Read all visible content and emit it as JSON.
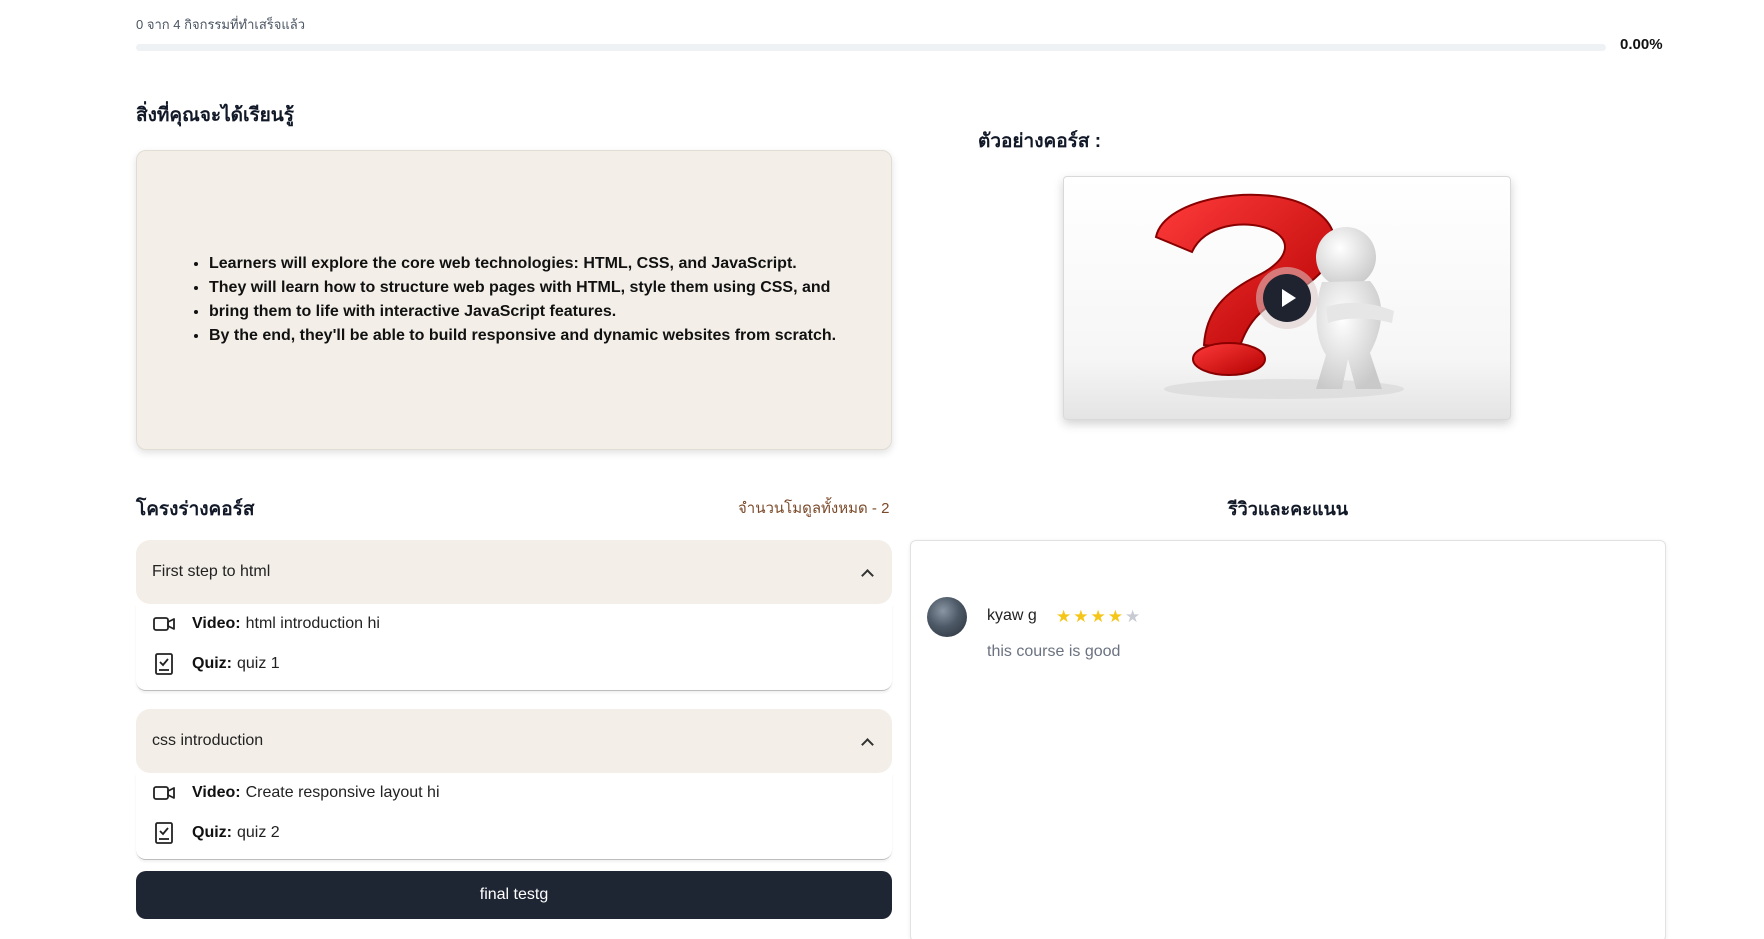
{
  "progress": {
    "text": "0 จาก 4 กิจกรรมที่ทำเสร็จแล้ว",
    "percent_label": "0.00%",
    "fraction": 0.0
  },
  "learn": {
    "title": "สิ่งที่คุณจะได้เรียนรู้",
    "items": [
      "Learners will explore the core web technologies: HTML, CSS, and JavaScript.",
      "They will learn how to structure web pages with HTML, style them using CSS, and",
      "bring them to life with interactive JavaScript features.",
      "By the end, they'll be able to build responsive and dynamic websites from scratch."
    ]
  },
  "preview": {
    "title": "ตัวอย่างคอร์ส :",
    "play_icon": "play-icon"
  },
  "outline": {
    "title": "โครงร่างคอร์ส",
    "module_count": "จำนวนโมดูลทั้งหมด - 2",
    "modules": [
      {
        "title": "First step to html",
        "lessons": [
          {
            "type": "Video:",
            "name": "html introduction hi",
            "icon": "video-icon"
          },
          {
            "type": "Quiz:",
            "name": "quiz 1",
            "icon": "quiz-icon"
          }
        ]
      },
      {
        "title": "css introduction",
        "lessons": [
          {
            "type": "Video:",
            "name": "Create responsive layout hi",
            "icon": "video-icon"
          },
          {
            "type": "Quiz:",
            "name": "quiz 2",
            "icon": "quiz-icon"
          }
        ]
      }
    ],
    "final_button": "final testg"
  },
  "reviews": {
    "title": "รีวิวและคะแนน",
    "items": [
      {
        "name": "kyaw g",
        "rating": 4,
        "max_rating": 5,
        "text": "this course is good"
      }
    ]
  },
  "colors": {
    "accent_dark": "#1e2533",
    "panel_beige": "#f3efe8",
    "star": "#f5c518",
    "module_count": "#7a4a2a"
  }
}
